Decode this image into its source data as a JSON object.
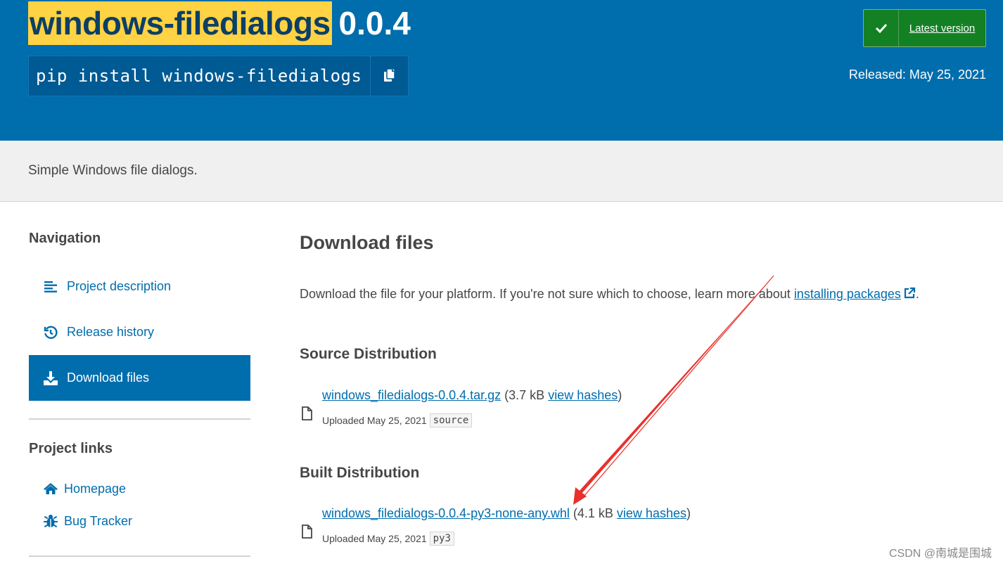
{
  "header": {
    "package_name": "windows-filedialogs",
    "version": "0.0.4",
    "pip_command": "pip install windows-filedialogs",
    "latest_label": "Latest version",
    "released": "Released: May 25, 2021"
  },
  "summary": "Simple Windows file dialogs.",
  "sidebar": {
    "nav_heading": "Navigation",
    "nav_items": [
      {
        "label": "Project description",
        "icon": "align-left-icon"
      },
      {
        "label": "Release history",
        "icon": "history-icon"
      },
      {
        "label": "Download files",
        "icon": "download-icon",
        "active": true
      }
    ],
    "links_heading": "Project links",
    "links": [
      {
        "label": "Homepage",
        "icon": "home-icon"
      },
      {
        "label": "Bug Tracker",
        "icon": "bug-icon"
      }
    ]
  },
  "main": {
    "title": "Download files",
    "intro_text": "Download the file for your platform. If you're not sure which to choose, learn more about ",
    "intro_link": "installing packages",
    "intro_end": ".",
    "source": {
      "heading": "Source Distribution",
      "filename": "windows_filedialogs-0.0.4.tar.gz",
      "size_prefix": " (3.7 kB ",
      "hashes_label": "view hashes",
      "size_suffix": ")",
      "uploaded": "Uploaded May 25, 2021",
      "tag": "source"
    },
    "built": {
      "heading": "Built Distribution",
      "filename": "windows_filedialogs-0.0.4-py3-none-any.whl",
      "size_prefix": " (4.1 kB ",
      "hashes_label": "view hashes",
      "size_suffix": ")",
      "uploaded": "Uploaded May 25, 2021",
      "tag": "py3"
    }
  },
  "watermark": "CSDN @南城是围城",
  "colors": {
    "brand_blue": "#006dad",
    "highlight_yellow": "#ffd343",
    "success_green": "#148024",
    "annotation_red": "#e8302c"
  }
}
